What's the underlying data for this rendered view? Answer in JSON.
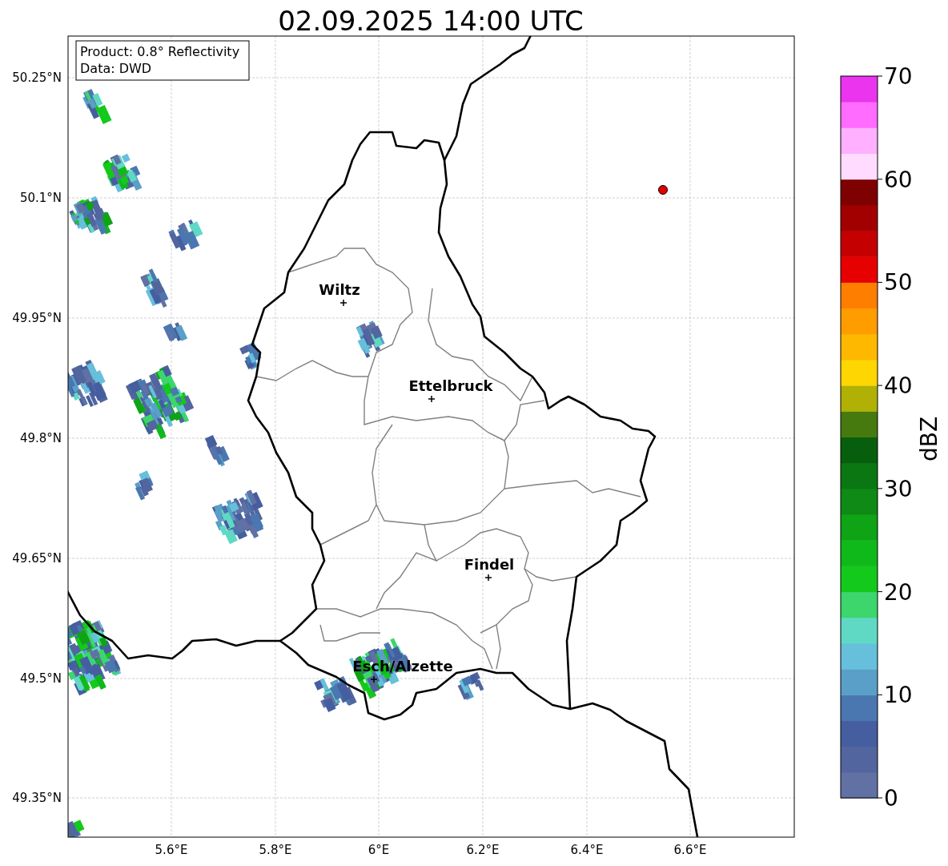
{
  "title": "02.09.2025 14:00 UTC",
  "info_box": [
    "Product: 0.8° Reflectivity",
    "Data: DWD"
  ],
  "map": {
    "y_ticks": [
      "50.25°N",
      "50.1°N",
      "49.95°N",
      "49.8°N",
      "49.65°N",
      "49.5°N",
      "49.35°N"
    ],
    "x_ticks": [
      "5.6°E",
      "5.8°E",
      "6°E",
      "6.2°E",
      "6.4°E",
      "6.6°E"
    ],
    "cities": [
      {
        "name": "Wiltz"
      },
      {
        "name": "Ettelbruck"
      },
      {
        "name": "Findel"
      },
      {
        "name": "Esch/Alzette"
      }
    ]
  },
  "colorbar": {
    "label": "dBZ",
    "ticks": [
      "70",
      "60",
      "50",
      "40",
      "30",
      "20",
      "10",
      "0"
    ],
    "bands": [
      {
        "color": "#6271a4"
      },
      {
        "color": "#53659e"
      },
      {
        "color": "#455e9f"
      },
      {
        "color": "#4a77b0"
      },
      {
        "color": "#5a9fc8"
      },
      {
        "color": "#66c0dc"
      },
      {
        "color": "#5fd9c4"
      },
      {
        "color": "#3cd66d"
      },
      {
        "color": "#13c91c"
      },
      {
        "color": "#10b91a"
      },
      {
        "color": "#0fa316"
      },
      {
        "color": "#0f8a16"
      },
      {
        "color": "#0b7712"
      },
      {
        "color": "#075f0d"
      },
      {
        "color": "#467a0e"
      },
      {
        "color": "#b0b005"
      },
      {
        "color": "#fed601"
      },
      {
        "color": "#feb800"
      },
      {
        "color": "#fe9c00"
      },
      {
        "color": "#fe7e00"
      },
      {
        "color": "#e60000"
      },
      {
        "color": "#c40000"
      },
      {
        "color": "#a20000"
      },
      {
        "color": "#7e0000"
      },
      {
        "color": "#ffdcff"
      },
      {
        "color": "#ffb0ff"
      },
      {
        "color": "#ff6cff"
      },
      {
        "color": "#eb34ee"
      }
    ]
  }
}
